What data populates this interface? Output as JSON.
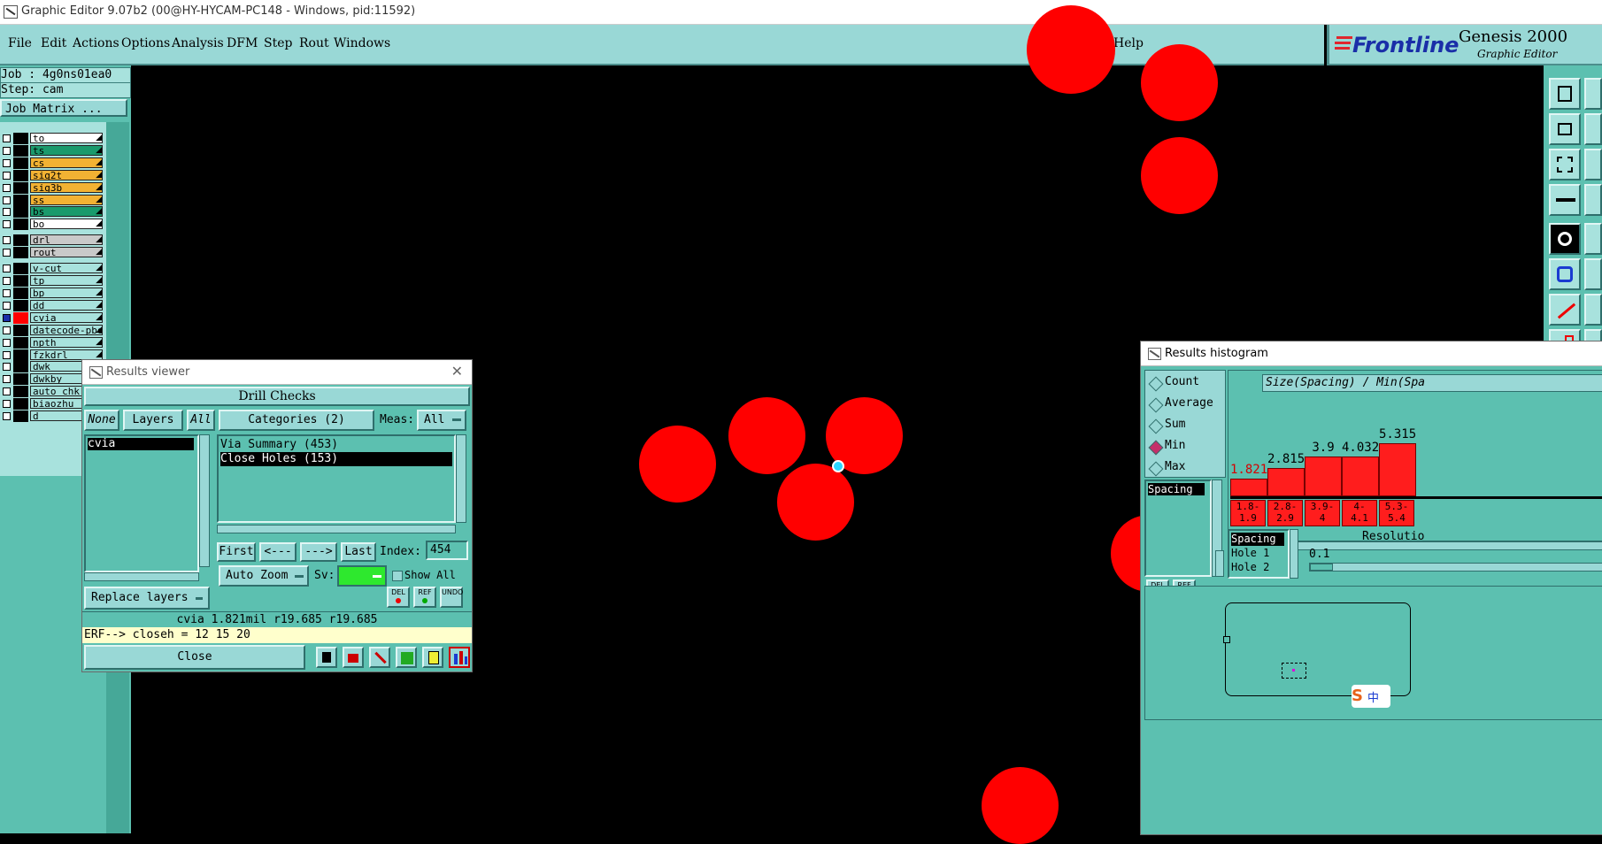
{
  "window": {
    "title": "Graphic Editor 9.07b2 (00@HY-HYCAM-PC148 - Windows, pid:11592)"
  },
  "menu": {
    "items": [
      "File",
      "Edit",
      "Actions",
      "Options",
      "Analysis",
      "DFM",
      "Step",
      "Rout",
      "Windows"
    ],
    "help": "Help"
  },
  "logo": {
    "brand": "Frontline",
    "product": "Genesis 2000",
    "subtitle": "Graphic Editor"
  },
  "left_panel": {
    "job": "Job : 4g0ns01ea0",
    "step": "Step: cam",
    "job_matrix": "Job Matrix ...",
    "layers": [
      {
        "name": "to",
        "color": "#ffffff"
      },
      {
        "name": "ts",
        "color": "#1a9a6c"
      },
      {
        "name": "cs",
        "color": "#f2b233"
      },
      {
        "name": "sig2t",
        "color": "#f2b233"
      },
      {
        "name": "sig3b",
        "color": "#f2b233"
      },
      {
        "name": "ss",
        "color": "#f2b233"
      },
      {
        "name": "bs",
        "color": "#1a9a6c"
      },
      {
        "name": "bo",
        "color": "#ffffff"
      },
      {
        "name": "drl",
        "color": "#c9c9c9"
      },
      {
        "name": "rout",
        "color": "#c9c9c9"
      },
      {
        "name": "v-cut",
        "color": "#a8e2dd"
      },
      {
        "name": "tp",
        "color": "#a8e2dd"
      },
      {
        "name": "bp",
        "color": "#a8e2dd"
      },
      {
        "name": "dd",
        "color": "#a8e2dd"
      },
      {
        "name": "cvia",
        "color": "#a8e2dd",
        "active": true
      },
      {
        "name": "datecode-pbe",
        "color": "#a8e2dd"
      },
      {
        "name": "npth",
        "color": "#a8e2dd"
      },
      {
        "name": "fzkdrl",
        "color": "#a8e2dd"
      },
      {
        "name": "dwk",
        "color": "#a8e2dd"
      },
      {
        "name": "dwkby",
        "color": "#a8e2dd"
      },
      {
        "name": "auto_chk_p",
        "color": "#a8e2dd"
      },
      {
        "name": "biaozhu",
        "color": "#a8e2dd"
      },
      {
        "name": "d",
        "color": "#a8e2dd"
      }
    ]
  },
  "results_viewer": {
    "title": "Results viewer",
    "header": "Drill Checks",
    "none": "None",
    "layers": "Layers",
    "all": "All",
    "layer_list": [
      "cvia"
    ],
    "categories": "Categories (2)",
    "meas_label": "Meas:",
    "meas_value": "All",
    "category_list": [
      "Via Summary (453)",
      "Close Holes (153)"
    ],
    "first": "First",
    "prev": "<---",
    "next": "--->",
    "last": "Last",
    "index_label": "Index:",
    "index_value": "454",
    "auto_zoom": "Auto Zoom",
    "sv_label": "Sv:",
    "show_all": "Show All",
    "replace_layers": "Replace layers",
    "status": "cvia 1.821mil  r19.685  r19.685",
    "erf": "ERF--> closeh = 12 15 20",
    "close": "Close",
    "small_buttons": [
      "DEL",
      "REF",
      "UNDO"
    ]
  },
  "histogram": {
    "title": "Results histogram",
    "options": [
      {
        "label": "Count",
        "on": false
      },
      {
        "label": "Average",
        "on": false
      },
      {
        "label": "Sum",
        "on": false
      },
      {
        "label": "Min",
        "on": true
      },
      {
        "label": "Max",
        "on": false
      }
    ],
    "list_item": "Spacing",
    "header": "Size(Spacing) / Min(Spa",
    "bars": [
      {
        "value": "1.821",
        "range": [
          "1.8-",
          "1.9"
        ],
        "level": 0.2,
        "highlight": true
      },
      {
        "value": "2.815",
        "range": [
          "2.8-",
          "2.9"
        ],
        "level": 0.32
      },
      {
        "value": "3.9",
        "range": [
          "3.9-",
          "4"
        ],
        "level": 0.45
      },
      {
        "value": "4.032",
        "range": [
          "4-",
          "4.1"
        ],
        "level": 0.45
      },
      {
        "value": "5.315",
        "range": [
          "5.3-",
          "5.4"
        ],
        "level": 0.6
      }
    ],
    "detail_list": [
      "Spacing",
      "Hole 1",
      "Hole 2"
    ],
    "resolution_label": "Resolutio",
    "resolution_value": "0.1",
    "small_buttons": [
      "DEL",
      "REF"
    ]
  },
  "ime": {
    "label": "中"
  },
  "colors": {
    "teal": "#5cc0b0",
    "light_teal": "#99d8d6",
    "pad_red": "#ff0000",
    "selection_cyan": "#2ad6ff"
  }
}
